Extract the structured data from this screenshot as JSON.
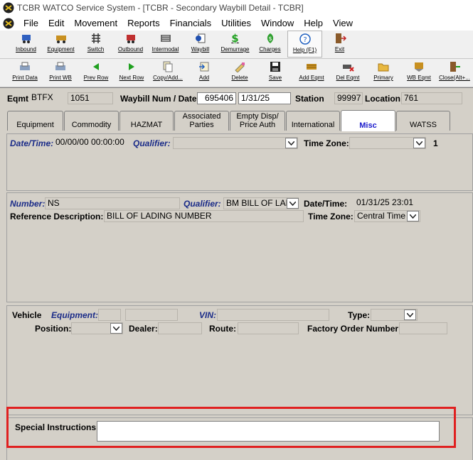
{
  "window": {
    "title": "TCBR WATCO Service System - [TCBR - Secondary Waybill Detail - TCBR]"
  },
  "menu": [
    "File",
    "Edit",
    "Movement",
    "Reports",
    "Financials",
    "Utilities",
    "Window",
    "Help",
    "View"
  ],
  "toolbar1": [
    {
      "label": "Inbound",
      "icon": "inbound-icon"
    },
    {
      "label": "Equipment",
      "icon": "equipment-icon"
    },
    {
      "label": "Switch",
      "icon": "switch-icon"
    },
    {
      "label": "Outbound",
      "icon": "outbound-icon"
    },
    {
      "label": "Intermodal",
      "icon": "intermodal-icon"
    },
    {
      "label": "Waybill",
      "icon": "waybill-icon"
    },
    {
      "label": "Demurrage",
      "icon": "demurrage-icon"
    },
    {
      "label": "Charges",
      "icon": "charges-icon"
    },
    {
      "label": "Help (F1)",
      "icon": "help-icon"
    },
    {
      "label": "Exit",
      "icon": "exit-icon"
    }
  ],
  "toolbar2": [
    {
      "label": "Print Data",
      "icon": "print-icon"
    },
    {
      "label": "Print WB",
      "icon": "print-wb-icon"
    },
    {
      "label": "Prev Row",
      "icon": "prev-row-icon"
    },
    {
      "label": "Next Row",
      "icon": "next-row-icon"
    },
    {
      "label": "Copy/Add...",
      "icon": "copy-add-icon"
    },
    {
      "label": "Add",
      "icon": "add-icon"
    },
    {
      "label": "Delete",
      "icon": "delete-icon"
    },
    {
      "label": "Save",
      "icon": "save-icon"
    },
    {
      "label": "Add Eqmt",
      "icon": "add-eqmt-icon"
    },
    {
      "label": "Del Eqmt",
      "icon": "del-eqmt-icon"
    },
    {
      "label": "Primary",
      "icon": "primary-icon"
    },
    {
      "label": "WB Eqmt",
      "icon": "wb-eqmt-icon"
    },
    {
      "label": "Close(Alt+...",
      "icon": "close-icon"
    }
  ],
  "header": {
    "eqmt_label": "Eqmt",
    "eqmt_init": "BTFX",
    "eqmt_num": "1051",
    "waybill_label": "Waybill Num / Date",
    "waybill_num": "695406",
    "waybill_date": "1/31/25",
    "station_label": "Station",
    "station": "99997",
    "location_label": "Location",
    "location": "761"
  },
  "tabs": [
    {
      "label": "Equipment"
    },
    {
      "label": "Commodity"
    },
    {
      "label": "HAZMAT"
    },
    {
      "label": "Associated Parties"
    },
    {
      "label": "Empty Disp/ Price Auth"
    },
    {
      "label": "International"
    },
    {
      "label": "Misc",
      "active": true
    },
    {
      "label": "WATSS"
    }
  ],
  "misc1": {
    "datetime_label": "Date/Time:",
    "datetime_value": "00/00/00 00:00:00",
    "qualifier_label": "Qualifier:",
    "qualifier_value": "",
    "timezone_label": "Time Zone:",
    "timezone_value": "",
    "count": "1"
  },
  "reference": {
    "number_label": "Number:",
    "number_value": "NS",
    "qualifier_label": "Qualifier:",
    "qualifier_value": "BM BILL OF LADII",
    "datetime_label": "Date/Time:",
    "datetime_value": "01/31/25 23:01",
    "desc_label": "Reference Description:",
    "desc_value": "BILL OF LADING NUMBER",
    "timezone_label": "Time Zone:",
    "timezone_value": "Central Time"
  },
  "vehicle": {
    "vehicle_label": "Vehicle",
    "equipment_label": "Equipment:",
    "vin_label": "VIN:",
    "type_label": "Type:",
    "position_label": "Position:",
    "dealer_label": "Dealer:",
    "route_label": "Route:",
    "factory_label": "Factory Order Number:"
  },
  "special": {
    "label": "Special Instructions:",
    "value": ""
  },
  "colors": {
    "highlight": "#e02020",
    "active_tab_text": "#1a1acc"
  }
}
